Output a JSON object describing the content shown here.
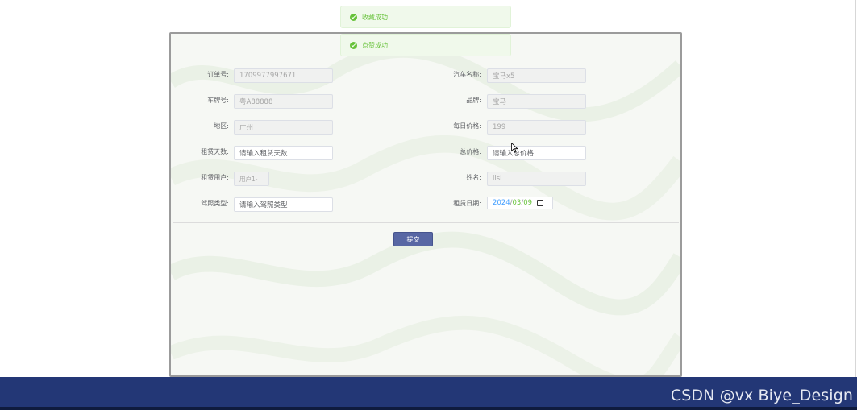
{
  "toasts": {
    "favorite": "收藏成功",
    "like": "点赞成功"
  },
  "form": {
    "order_no": {
      "label": "订单号:",
      "value": "1709977997671"
    },
    "car_name": {
      "label": "汽车名称:",
      "value": "宝马x5"
    },
    "plate_no": {
      "label": "车牌号:",
      "value": "粤A88888"
    },
    "brand": {
      "label": "品牌:",
      "value": "宝马"
    },
    "region": {
      "label": "地区:",
      "value": "广州"
    },
    "daily_price": {
      "label": "每日价格:",
      "value": "199"
    },
    "rental_days": {
      "label": "租赁天数:",
      "placeholder": "请输入租赁天数"
    },
    "total_price": {
      "label": "总价格:",
      "placeholder": "请输入总价格"
    },
    "rental_user": {
      "label": "租赁用户:",
      "value": "用户1-"
    },
    "name": {
      "label": "姓名:",
      "value": "lisi"
    },
    "license_type": {
      "label": "驾照类型:",
      "placeholder": "请输入驾照类型"
    },
    "rental_date": {
      "label": "租赁日期:",
      "year": "2024",
      "month": "03",
      "day": "09",
      "sep": "/"
    }
  },
  "submit_label": "提交",
  "watermark": "CSDN @vx Biye_Design",
  "colors": {
    "footer": "#233776",
    "success": "#67c23a",
    "button": "#5867a4"
  }
}
